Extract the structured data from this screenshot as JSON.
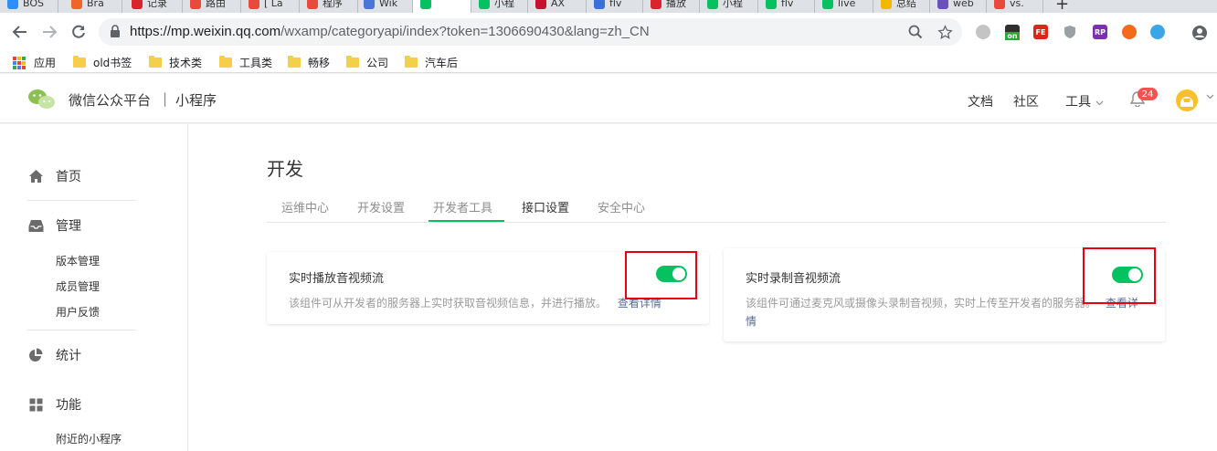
{
  "browser": {
    "tabs": [
      {
        "label": "BOS",
        "color": "#2c8ef8",
        "active": false
      },
      {
        "label": "Bra",
        "color": "#f0652a",
        "active": false
      },
      {
        "label": "记录",
        "color": "#d9232d",
        "active": false
      },
      {
        "label": "路由",
        "color": "#e84a3c",
        "active": false
      },
      {
        "label": "[ La",
        "color": "#e84a3c",
        "active": false
      },
      {
        "label": "程序",
        "color": "#e84a3c",
        "active": false
      },
      {
        "label": "Wik",
        "color": "#4a76d9",
        "active": false
      },
      {
        "label": "",
        "color": "#07c160",
        "active": true
      },
      {
        "label": "小程",
        "color": "#07c160",
        "active": false
      },
      {
        "label": "AX",
        "color": "#c8102e",
        "active": false
      },
      {
        "label": "flv",
        "color": "#3b6fd8",
        "active": false
      },
      {
        "label": "播放",
        "color": "#d9232d",
        "active": false
      },
      {
        "label": "小程",
        "color": "#07c160",
        "active": false
      },
      {
        "label": "flv",
        "color": "#07c160",
        "active": false
      },
      {
        "label": "live",
        "color": "#07c160",
        "active": false
      },
      {
        "label": "总结",
        "color": "#f2b800",
        "active": false
      },
      {
        "label": "web",
        "color": "#6b4fbb",
        "active": false
      },
      {
        "label": "vs.",
        "color": "#e84a3c",
        "active": false
      }
    ],
    "url_host": "https://mp.weixin.qq.com",
    "url_path": "/wxamp/categoryapi/index?token=1306690430&lang=zh_CN",
    "bookmarks": {
      "apps": "应用",
      "items": [
        "old书签",
        "技术类",
        "工具类",
        "畅移",
        "公司",
        "汽车后"
      ]
    },
    "extensions": {
      "on_label": "on",
      "fe_label": "FE",
      "rp_label": "RP"
    }
  },
  "header": {
    "brand": "微信公众平台",
    "separator": "|",
    "product": "小程序",
    "nav": {
      "docs": "文档",
      "community": "社区",
      "tools": "工具"
    },
    "notification_count": "24"
  },
  "sidebar": {
    "home": "首页",
    "manage": "管理",
    "manage_items": [
      "版本管理",
      "成员管理",
      "用户反馈"
    ],
    "stats": "统计",
    "features": "功能",
    "feature_items": [
      "附近的小程序"
    ]
  },
  "page": {
    "title": "开发",
    "tabs": [
      "运维中心",
      "开发设置",
      "开发者工具",
      "接口设置",
      "安全中心"
    ],
    "active_tab": "接口设置"
  },
  "cards": [
    {
      "title": "实时播放音视频流",
      "desc": "该组件可从开发者的服务器上实时获取音视频信息，并进行播放。",
      "link": "查看详情",
      "enabled": true
    },
    {
      "title": "实时录制音视频流",
      "desc": "该组件可通过麦克风或摄像头录制音视频，实时上传至开发者的服务器。",
      "link_part1": "查看详",
      "link_part2": "情",
      "enabled": true
    }
  ],
  "colors": {
    "accent": "#07c160",
    "link": "#576b95",
    "highlight_box": "#e60012",
    "badge": "#fa5151"
  }
}
